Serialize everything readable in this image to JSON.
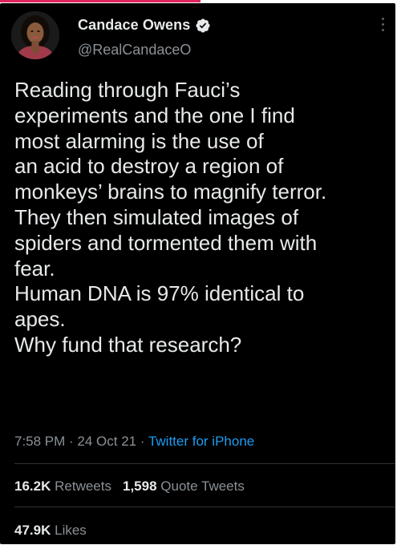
{
  "colors": {
    "background": "#000000",
    "text_primary": "#e7e9ea",
    "text_secondary": "#8b9196",
    "link": "#1d9bf0",
    "verified": "#e7e9ea",
    "divider": "#2f3336"
  },
  "author": {
    "display_name": "Candace Owens",
    "handle": "@RealCandaceO",
    "verified": true,
    "avatar_icon": "profile-photo"
  },
  "tweet": {
    "lines": [
      "Reading through Fauci’s",
      "experiments and the one I find",
      "most alarming is the use of",
      "an acid to destroy a region of",
      "monkeys’ brains to magnify terror.",
      "They then simulated images of",
      "spiders and tormented them with",
      "fear.",
      "Human DNA is 97% identical to",
      "apes.",
      "Why fund that research?"
    ]
  },
  "meta": {
    "time": "7:58 PM",
    "separator1": " · ",
    "date": "24 Oct 21",
    "separator2": " · ",
    "source": "Twitter for iPhone"
  },
  "stats": {
    "retweets_count": "16.2K",
    "retweets_label": "Retweets",
    "quotes_count": "1,598",
    "quotes_label": "Quote Tweets",
    "likes_count": "47.9K",
    "likes_label": "Likes"
  }
}
